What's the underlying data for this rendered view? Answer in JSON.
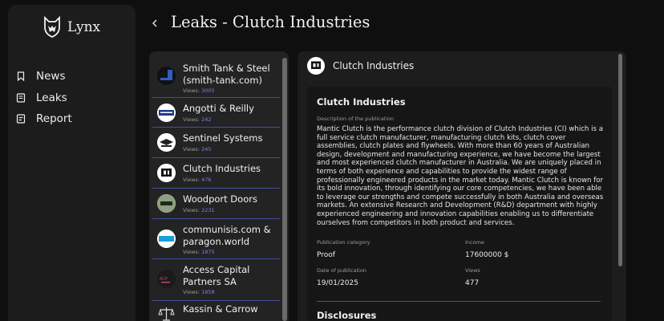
{
  "app": {
    "name": "Lynx"
  },
  "nav": [
    {
      "label": "News",
      "icon": "bookmark-icon"
    },
    {
      "label": "Leaks",
      "icon": "file-icon"
    },
    {
      "label": "Report",
      "icon": "report-icon"
    }
  ],
  "header": {
    "title": "Leaks - Clutch Industries"
  },
  "list": {
    "views_label": "Views:",
    "items": [
      {
        "name": "Smith Tank & Steel (smith-tank.com)",
        "views": "3005"
      },
      {
        "name": "Angotti & Reilly",
        "views": "242"
      },
      {
        "name": "Sentinel Systems",
        "views": "245"
      },
      {
        "name": "Clutch Industries",
        "views": "476"
      },
      {
        "name": "Woodport Doors",
        "views": "2231"
      },
      {
        "name": "communisis.com & paragon.world",
        "views": "1875"
      },
      {
        "name": "Access Capital Partners SA",
        "views": "1858"
      },
      {
        "name": "Kassin & Carrow",
        "views": ""
      }
    ]
  },
  "detail": {
    "company": "Clutch Industries",
    "card_title": "Clutch Industries",
    "description_label": "Description of the publication",
    "description": "Mantic Clutch is the performance clutch division of Clutch Industries (CI) which is a full service clutch manufacturer, manufacturing clutch kits, clutch cover assemblies, clutch plates and flywheels. With more than 60 years of Australian design, development and manufacturing experience, we have become the largest and most experienced clutch manufacturer in Australia. We are uniquely placed in terms of both experience and capabilities to provide the widest range of professionally engineered products in the market today. Mantic Clutch is known for its bold innovation, through identifying our core competencies, we have been able to leverage our strengths and compete successfully in both Australia and overseas markets. An extensive Research and Development (R&D) department with highly experienced engineering and innovation capabilities enabling us to differentiate ourselves from competitors in both product and services.",
    "category_label": "Publication category",
    "category": "Proof",
    "income_label": "Income",
    "income": "17600000 $",
    "date_label": "Date of publication",
    "date": "19/01/2025",
    "views_label": "Views",
    "views": "477",
    "disclosures_label": "Disclosures"
  },
  "colors": {
    "accent": "#4250a0",
    "views_number": "#6f86e8"
  }
}
